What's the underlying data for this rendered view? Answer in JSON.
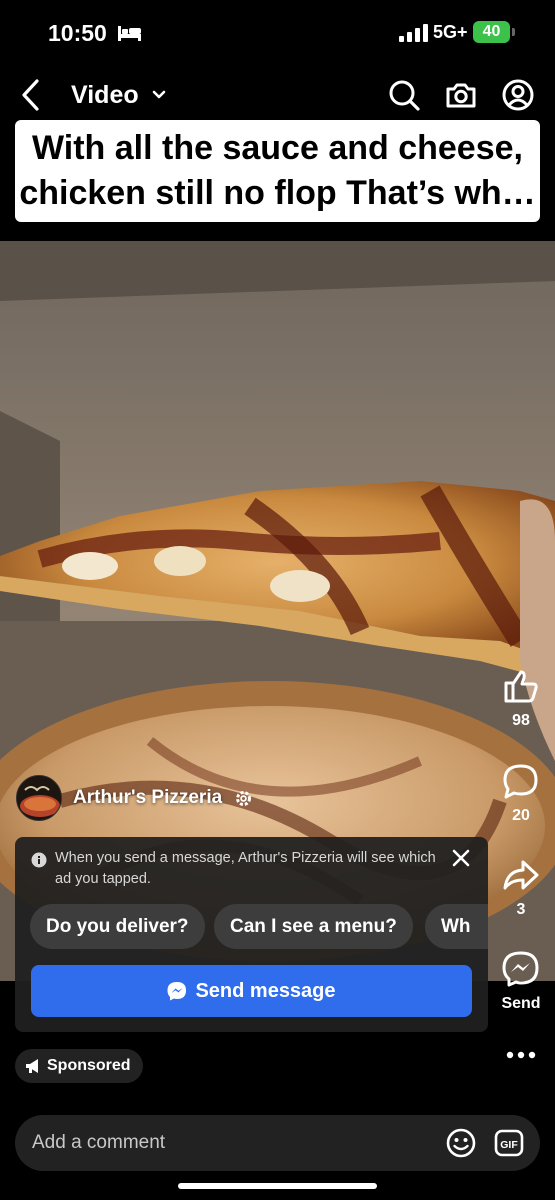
{
  "status_bar": {
    "time": "10:50",
    "network": "5G+",
    "battery": "40"
  },
  "nav": {
    "title": "Video"
  },
  "caption": {
    "line1": "With all the sauce and cheese,",
    "line2": "chicken still no flop That’s wh…"
  },
  "actions": {
    "likes": "98",
    "comments": "20",
    "shares": "3",
    "send_label": "Send"
  },
  "page": {
    "name": "Arthur's Pizzeria"
  },
  "message_panel": {
    "notice": "When you send a message, Arthur's Pizzeria will see which ad you tapped.",
    "quick_replies": [
      "Do you deliver?",
      "Can I see a menu?",
      "Wh"
    ],
    "send_button": "Send message"
  },
  "sponsored_label": "Sponsored",
  "comment": {
    "placeholder": "Add a comment"
  },
  "colors": {
    "accent": "#2f6ded",
    "battery": "#3cc24a"
  }
}
